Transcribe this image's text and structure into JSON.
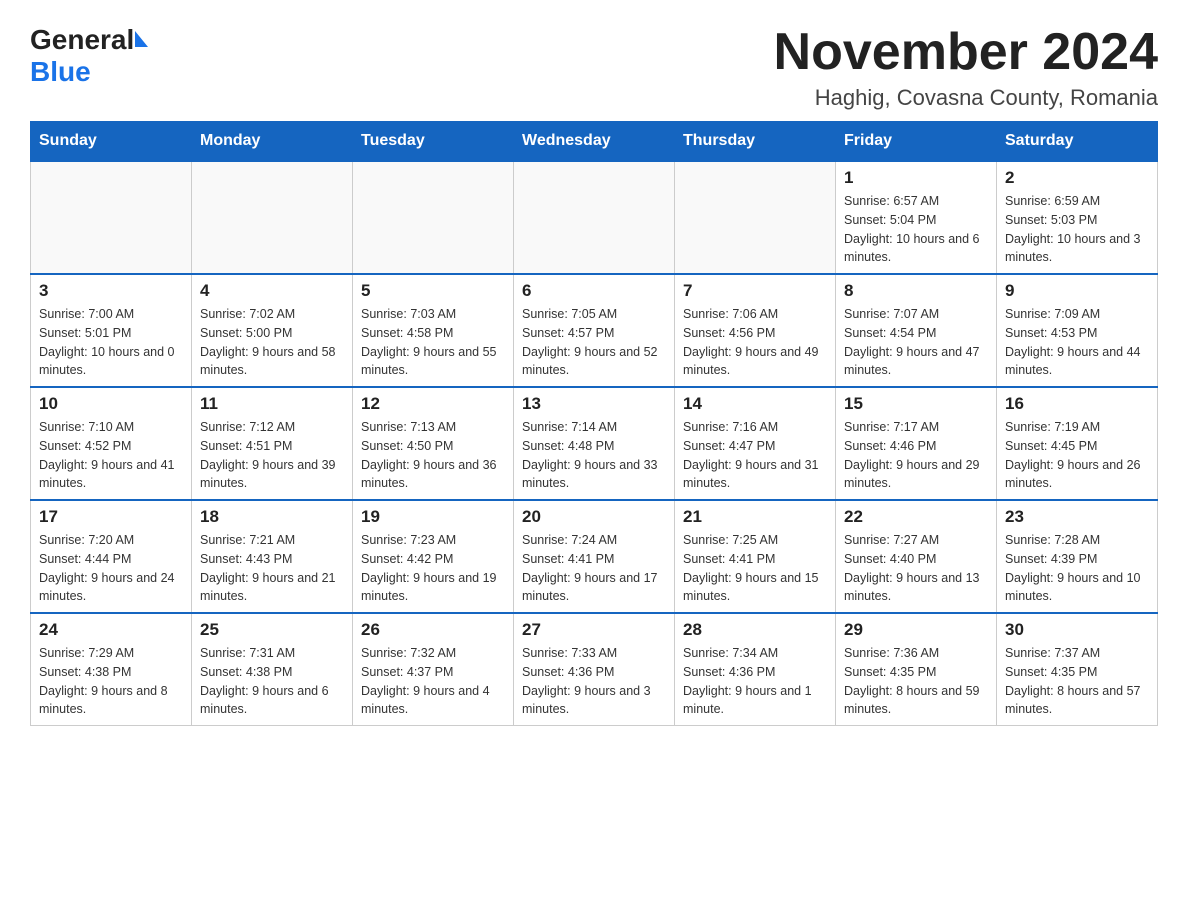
{
  "logo": {
    "general": "General",
    "blue": "Blue"
  },
  "title": "November 2024",
  "subtitle": "Haghig, Covasna County, Romania",
  "days_of_week": [
    "Sunday",
    "Monday",
    "Tuesday",
    "Wednesday",
    "Thursday",
    "Friday",
    "Saturday"
  ],
  "weeks": [
    [
      {
        "day": "",
        "info": ""
      },
      {
        "day": "",
        "info": ""
      },
      {
        "day": "",
        "info": ""
      },
      {
        "day": "",
        "info": ""
      },
      {
        "day": "",
        "info": ""
      },
      {
        "day": "1",
        "info": "Sunrise: 6:57 AM\nSunset: 5:04 PM\nDaylight: 10 hours and 6 minutes."
      },
      {
        "day": "2",
        "info": "Sunrise: 6:59 AM\nSunset: 5:03 PM\nDaylight: 10 hours and 3 minutes."
      }
    ],
    [
      {
        "day": "3",
        "info": "Sunrise: 7:00 AM\nSunset: 5:01 PM\nDaylight: 10 hours and 0 minutes."
      },
      {
        "day": "4",
        "info": "Sunrise: 7:02 AM\nSunset: 5:00 PM\nDaylight: 9 hours and 58 minutes."
      },
      {
        "day": "5",
        "info": "Sunrise: 7:03 AM\nSunset: 4:58 PM\nDaylight: 9 hours and 55 minutes."
      },
      {
        "day": "6",
        "info": "Sunrise: 7:05 AM\nSunset: 4:57 PM\nDaylight: 9 hours and 52 minutes."
      },
      {
        "day": "7",
        "info": "Sunrise: 7:06 AM\nSunset: 4:56 PM\nDaylight: 9 hours and 49 minutes."
      },
      {
        "day": "8",
        "info": "Sunrise: 7:07 AM\nSunset: 4:54 PM\nDaylight: 9 hours and 47 minutes."
      },
      {
        "day": "9",
        "info": "Sunrise: 7:09 AM\nSunset: 4:53 PM\nDaylight: 9 hours and 44 minutes."
      }
    ],
    [
      {
        "day": "10",
        "info": "Sunrise: 7:10 AM\nSunset: 4:52 PM\nDaylight: 9 hours and 41 minutes."
      },
      {
        "day": "11",
        "info": "Sunrise: 7:12 AM\nSunset: 4:51 PM\nDaylight: 9 hours and 39 minutes."
      },
      {
        "day": "12",
        "info": "Sunrise: 7:13 AM\nSunset: 4:50 PM\nDaylight: 9 hours and 36 minutes."
      },
      {
        "day": "13",
        "info": "Sunrise: 7:14 AM\nSunset: 4:48 PM\nDaylight: 9 hours and 33 minutes."
      },
      {
        "day": "14",
        "info": "Sunrise: 7:16 AM\nSunset: 4:47 PM\nDaylight: 9 hours and 31 minutes."
      },
      {
        "day": "15",
        "info": "Sunrise: 7:17 AM\nSunset: 4:46 PM\nDaylight: 9 hours and 29 minutes."
      },
      {
        "day": "16",
        "info": "Sunrise: 7:19 AM\nSunset: 4:45 PM\nDaylight: 9 hours and 26 minutes."
      }
    ],
    [
      {
        "day": "17",
        "info": "Sunrise: 7:20 AM\nSunset: 4:44 PM\nDaylight: 9 hours and 24 minutes."
      },
      {
        "day": "18",
        "info": "Sunrise: 7:21 AM\nSunset: 4:43 PM\nDaylight: 9 hours and 21 minutes."
      },
      {
        "day": "19",
        "info": "Sunrise: 7:23 AM\nSunset: 4:42 PM\nDaylight: 9 hours and 19 minutes."
      },
      {
        "day": "20",
        "info": "Sunrise: 7:24 AM\nSunset: 4:41 PM\nDaylight: 9 hours and 17 minutes."
      },
      {
        "day": "21",
        "info": "Sunrise: 7:25 AM\nSunset: 4:41 PM\nDaylight: 9 hours and 15 minutes."
      },
      {
        "day": "22",
        "info": "Sunrise: 7:27 AM\nSunset: 4:40 PM\nDaylight: 9 hours and 13 minutes."
      },
      {
        "day": "23",
        "info": "Sunrise: 7:28 AM\nSunset: 4:39 PM\nDaylight: 9 hours and 10 minutes."
      }
    ],
    [
      {
        "day": "24",
        "info": "Sunrise: 7:29 AM\nSunset: 4:38 PM\nDaylight: 9 hours and 8 minutes."
      },
      {
        "day": "25",
        "info": "Sunrise: 7:31 AM\nSunset: 4:38 PM\nDaylight: 9 hours and 6 minutes."
      },
      {
        "day": "26",
        "info": "Sunrise: 7:32 AM\nSunset: 4:37 PM\nDaylight: 9 hours and 4 minutes."
      },
      {
        "day": "27",
        "info": "Sunrise: 7:33 AM\nSunset: 4:36 PM\nDaylight: 9 hours and 3 minutes."
      },
      {
        "day": "28",
        "info": "Sunrise: 7:34 AM\nSunset: 4:36 PM\nDaylight: 9 hours and 1 minute."
      },
      {
        "day": "29",
        "info": "Sunrise: 7:36 AM\nSunset: 4:35 PM\nDaylight: 8 hours and 59 minutes."
      },
      {
        "day": "30",
        "info": "Sunrise: 7:37 AM\nSunset: 4:35 PM\nDaylight: 8 hours and 57 minutes."
      }
    ]
  ]
}
